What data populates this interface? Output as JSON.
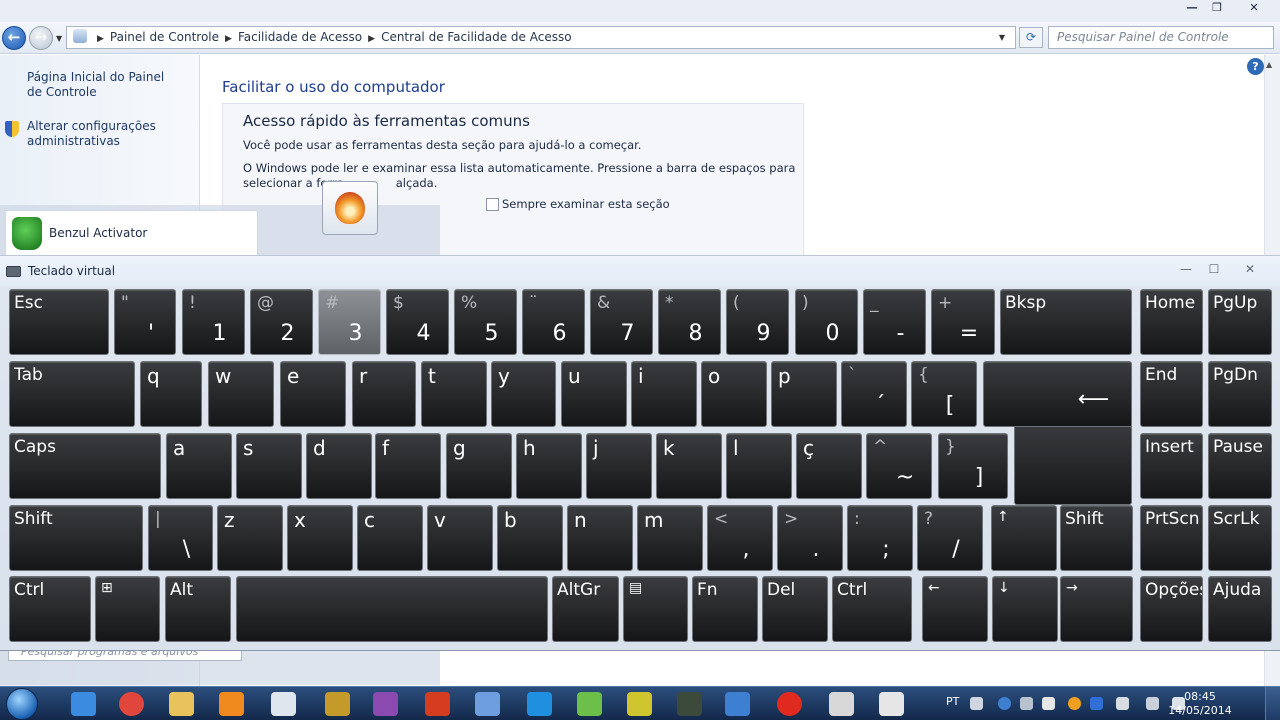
{
  "control_panel": {
    "breadcrumb": [
      "Painel de Controle",
      "Facilidade de Acesso",
      "Central de Facilidade de Acesso"
    ],
    "search_placeholder": "Pesquisar Painel de Controle",
    "left_links": [
      "Página Inicial do Painel de Controle",
      "Alterar configurações administrativas"
    ],
    "heading": "Facilitar o uso do computador",
    "quick_access": {
      "title": "Acesso rápido às ferramentas comuns",
      "line1": "Você pode usar as ferramentas desta seção para ajudá-lo a começar.",
      "line2": "O Windows pode ler e examinar essa lista automaticamente. Pressione a barra de espaços para",
      "line3": "selecionar a ferra",
      "line3_tail": "alçada.",
      "checkbox_scan": "Sempre examinar esta seção"
    }
  },
  "start_menu": {
    "activator_label": "Benzul Activator",
    "search_placeholder": "Pesquisar programas e arquivos"
  },
  "osk": {
    "title": "Teclado virtual",
    "rows": [
      [
        {
          "name": "key-esc",
          "type": "func",
          "label": "Esc"
        },
        {
          "name": "key-quote",
          "type": "dual",
          "top": "\"",
          "main": "'"
        },
        {
          "name": "key-1",
          "type": "dual",
          "top": "!",
          "main": "1"
        },
        {
          "name": "key-2",
          "type": "dual",
          "top": "@",
          "main": "2"
        },
        {
          "name": "key-3",
          "type": "dual",
          "top": "#",
          "main": "3",
          "pressed": true
        },
        {
          "name": "key-4",
          "type": "dual",
          "top": "$",
          "main": "4"
        },
        {
          "name": "key-5",
          "type": "dual",
          "top": "%",
          "main": "5"
        },
        {
          "name": "key-6",
          "type": "dual",
          "top": "¨",
          "main": "6"
        },
        {
          "name": "key-7",
          "type": "dual",
          "top": "&",
          "main": "7"
        },
        {
          "name": "key-8",
          "type": "dual",
          "top": "*",
          "main": "8"
        },
        {
          "name": "key-9",
          "type": "dual",
          "top": "(",
          "main": "9"
        },
        {
          "name": "key-0",
          "type": "dual",
          "top": ")",
          "main": "0"
        },
        {
          "name": "key-minus",
          "type": "dual",
          "top": "_",
          "main": "-"
        },
        {
          "name": "key-equals",
          "type": "dual",
          "top": "+",
          "main": "="
        },
        {
          "name": "key-bksp",
          "type": "func",
          "label": "Bksp"
        },
        {
          "name": "key-home",
          "type": "func",
          "label": "Home"
        },
        {
          "name": "key-pgup",
          "type": "func",
          "label": "PgUp"
        }
      ],
      [
        {
          "name": "key-tab",
          "type": "func",
          "label": "Tab"
        },
        {
          "name": "key-q",
          "type": "letter",
          "label": "q"
        },
        {
          "name": "key-w",
          "type": "letter",
          "label": "w"
        },
        {
          "name": "key-e",
          "type": "letter",
          "label": "e"
        },
        {
          "name": "key-r",
          "type": "letter",
          "label": "r"
        },
        {
          "name": "key-t",
          "type": "letter",
          "label": "t"
        },
        {
          "name": "key-y",
          "type": "letter",
          "label": "y"
        },
        {
          "name": "key-u",
          "type": "letter",
          "label": "u"
        },
        {
          "name": "key-i",
          "type": "letter",
          "label": "i"
        },
        {
          "name": "key-o",
          "type": "letter",
          "label": "o"
        },
        {
          "name": "key-p",
          "type": "letter",
          "label": "p"
        },
        {
          "name": "key-acute",
          "type": "dual",
          "top": "`",
          "main": "´"
        },
        {
          "name": "key-bracket-open",
          "type": "dual",
          "top": "{",
          "main": "["
        },
        {
          "name": "key-enter",
          "type": "enter",
          "label": "⟵"
        },
        {
          "name": "key-end",
          "type": "func",
          "label": "End"
        },
        {
          "name": "key-pgdn",
          "type": "func",
          "label": "PgDn"
        }
      ],
      [
        {
          "name": "key-caps",
          "type": "func",
          "label": "Caps"
        },
        {
          "name": "key-a",
          "type": "letter",
          "label": "a"
        },
        {
          "name": "key-s",
          "type": "letter",
          "label": "s"
        },
        {
          "name": "key-d",
          "type": "letter",
          "label": "d"
        },
        {
          "name": "key-f",
          "type": "letter",
          "label": "f"
        },
        {
          "name": "key-g",
          "type": "letter",
          "label": "g"
        },
        {
          "name": "key-h",
          "type": "letter",
          "label": "h"
        },
        {
          "name": "key-j",
          "type": "letter",
          "label": "j"
        },
        {
          "name": "key-k",
          "type": "letter",
          "label": "k"
        },
        {
          "name": "key-l",
          "type": "letter",
          "label": "l"
        },
        {
          "name": "key-cedilla",
          "type": "letter",
          "label": "ç"
        },
        {
          "name": "key-tilde",
          "type": "dual",
          "top": "^",
          "main": "~"
        },
        {
          "name": "key-bracket-close",
          "type": "dual",
          "top": "}",
          "main": "]"
        },
        {
          "name": "key-insert",
          "type": "func",
          "label": "Insert"
        },
        {
          "name": "key-pause",
          "type": "func",
          "label": "Pause"
        }
      ],
      [
        {
          "name": "key-shift-left",
          "type": "func",
          "label": "Shift"
        },
        {
          "name": "key-backslash",
          "type": "dual",
          "top": "|",
          "main": "\\"
        },
        {
          "name": "key-z",
          "type": "letter",
          "label": "z"
        },
        {
          "name": "key-x",
          "type": "letter",
          "label": "x"
        },
        {
          "name": "key-c",
          "type": "letter",
          "label": "c"
        },
        {
          "name": "key-v",
          "type": "letter",
          "label": "v"
        },
        {
          "name": "key-b",
          "type": "letter",
          "label": "b"
        },
        {
          "name": "key-n",
          "type": "letter",
          "label": "n"
        },
        {
          "name": "key-m",
          "type": "letter",
          "label": "m"
        },
        {
          "name": "key-comma",
          "type": "dual",
          "top": "<",
          "main": ","
        },
        {
          "name": "key-period",
          "type": "dual",
          "top": ">",
          "main": "."
        },
        {
          "name": "key-semicolon",
          "type": "dual",
          "top": ":",
          "main": ";"
        },
        {
          "name": "key-slash",
          "type": "dual",
          "top": "?",
          "main": "/"
        },
        {
          "name": "key-up",
          "type": "small",
          "label": "↑"
        },
        {
          "name": "key-shift-right",
          "type": "func",
          "label": "Shift"
        },
        {
          "name": "key-prtscn",
          "type": "func",
          "label": "PrtScn"
        },
        {
          "name": "key-scrlk",
          "type": "func",
          "label": "ScrLk"
        }
      ],
      [
        {
          "name": "key-ctrl-left",
          "type": "func",
          "label": "Ctrl"
        },
        {
          "name": "key-win",
          "type": "small",
          "label": "⊞"
        },
        {
          "name": "key-alt",
          "type": "func",
          "label": "Alt"
        },
        {
          "name": "key-space",
          "type": "func",
          "label": ""
        },
        {
          "name": "key-altgr",
          "type": "func",
          "label": "AltGr"
        },
        {
          "name": "key-menu",
          "type": "small",
          "label": "▤"
        },
        {
          "name": "key-fn",
          "type": "func",
          "label": "Fn"
        },
        {
          "name": "key-del",
          "type": "func",
          "label": "Del"
        },
        {
          "name": "key-ctrl-right",
          "type": "func",
          "label": "Ctrl"
        },
        {
          "name": "key-left",
          "type": "small",
          "label": "←"
        },
        {
          "name": "key-down",
          "type": "small",
          "label": "↓"
        },
        {
          "name": "key-right",
          "type": "small",
          "label": "→"
        },
        {
          "name": "key-options",
          "type": "func",
          "label": "Opções"
        },
        {
          "name": "key-help",
          "type": "func",
          "label": "Ajuda"
        }
      ]
    ]
  },
  "taskbar": {
    "language": "PT",
    "time": "08:45",
    "date": "14/05/2014",
    "apps": [
      "internet-explorer-icon",
      "chrome-icon",
      "folder-icon",
      "media-player-icon",
      "notepad-icon",
      "league-icon",
      "game-avatar-icon",
      "blaze-icon",
      "diamond-app-icon",
      "teamviewer-icon",
      "tool-icon",
      "number-app-icon",
      "terminal-icon",
      "transfer-icon",
      "record-icon",
      "gamepad-icon",
      "face-app-icon"
    ]
  },
  "colors": {
    "accent": "#1e3d8f",
    "key_face": "#1f2022",
    "key_pressed": "#7a7d82",
    "taskbar": "#1c3a64"
  }
}
